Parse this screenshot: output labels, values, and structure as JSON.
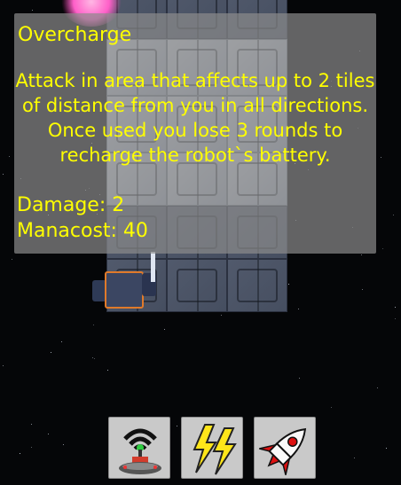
{
  "tooltip": {
    "title": "Overcharge",
    "description_lines": [
      "Attack in area that affects up to 2 tiles",
      "of distance from you in all directions.",
      "Once used you lose 3 rounds to",
      "recharge the robot`s battery."
    ],
    "damage": "Damage: 2",
    "manacost": "Manacost: 40",
    "text_color": "#ffff00",
    "background_color": "#8c8c8c"
  },
  "skills": [
    {
      "icon": "signal-tower-icon"
    },
    {
      "icon": "lightning-bolts-icon"
    },
    {
      "icon": "rocket-icon"
    }
  ],
  "colors": {
    "space": "#050608",
    "tile": "#4a5366",
    "portal": "#ff5fc8",
    "robot_outline": "#e07a2a"
  }
}
